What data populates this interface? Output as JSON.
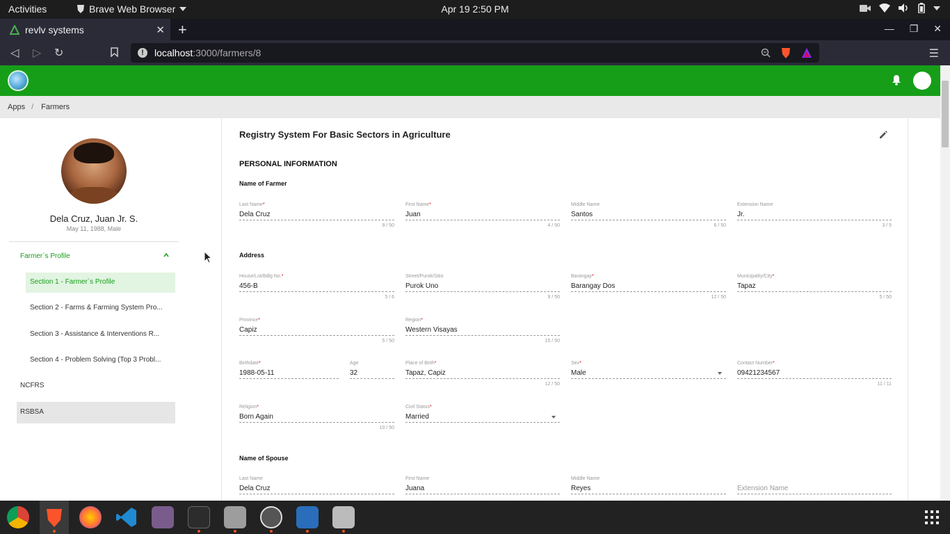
{
  "system": {
    "activities": "Activities",
    "app_menu": "Brave Web Browser",
    "clock": "Apr 19   2:50 PM"
  },
  "browser": {
    "tab_title": "revlv systems",
    "url_host": "localhost",
    "url_path": ":3000/farmers/8"
  },
  "breadcrumb": [
    "Apps",
    "Farmers"
  ],
  "profile": {
    "name": "Dela Cruz, Juan Jr. S.",
    "meta": "May 11, 1988, Male"
  },
  "nav": {
    "farmers_profile": "Farmer`s Profile",
    "sections": [
      "Section 1 - Farmer`s Profile",
      "Section 2 - Farms & Farming System Pro...",
      "Section 3 - Assistance & Interventions R...",
      "Section 4 - Problem Solving (Top 3 Probl..."
    ],
    "ncfrs": "NCFRS",
    "rsbsa": "RSBSA"
  },
  "card": {
    "title": "Registry System For Basic Sectors in Agriculture",
    "personal_info": "PERSONAL INFORMATION",
    "name_of_farmer": "Name of Farmer",
    "address": "Address",
    "name_of_spouse": "Name of Spouse"
  },
  "farmer_name": {
    "last": {
      "label": "Last Name",
      "value": "Dela Cruz",
      "counter": "9 / 50"
    },
    "first": {
      "label": "First Name",
      "value": "Juan",
      "counter": "4 / 50"
    },
    "middle": {
      "label": "Middle Name",
      "value": "Santos",
      "counter": "6 / 50"
    },
    "ext": {
      "label": "Extension Name",
      "value": "Jr.",
      "counter": "3 / 5"
    }
  },
  "address": {
    "house": {
      "label": "House/Lot/Bdlg No.",
      "value": "456-B",
      "counter": "5 / 6"
    },
    "street": {
      "label": "Street/Purok/Sitio",
      "value": "Purok Uno",
      "counter": "9 / 50"
    },
    "barangay": {
      "label": "Barangay",
      "value": "Barangay Dos",
      "counter": "12 / 50"
    },
    "municipality": {
      "label": "Municipality/City",
      "value": "Tapaz",
      "counter": "5 / 50"
    },
    "province": {
      "label": "Province",
      "value": "Capiz",
      "counter": "5 / 50"
    },
    "region": {
      "label": "Region",
      "value": "Western Visayas",
      "counter": "15 / 50"
    }
  },
  "details": {
    "birthdate": {
      "label": "Birthdate",
      "value": "1988-05-11"
    },
    "age": {
      "label": "Age",
      "value": "32"
    },
    "birthplace": {
      "label": "Place of Birth",
      "value": "Tapaz, Capiz",
      "counter": "12 / 50"
    },
    "sex": {
      "label": "Sex",
      "value": "Male"
    },
    "contact": {
      "label": "Contact Number",
      "value": "09421234567",
      "counter": "11 / 11"
    },
    "religion": {
      "label": "Religion",
      "value": "Born Again",
      "counter": "10 / 50"
    },
    "civil_status": {
      "label": "Civil Status",
      "value": "Married"
    }
  },
  "spouse": {
    "last": {
      "label": "Last Name",
      "value": "Dela Cruz"
    },
    "first": {
      "label": "First Name",
      "value": "Juana"
    },
    "middle": {
      "label": "Middle Name",
      "value": "Reyes"
    },
    "ext": {
      "placeholder": "Extension Name"
    }
  },
  "colors": {
    "brand_green": "#169e18",
    "required": "#e00000"
  }
}
